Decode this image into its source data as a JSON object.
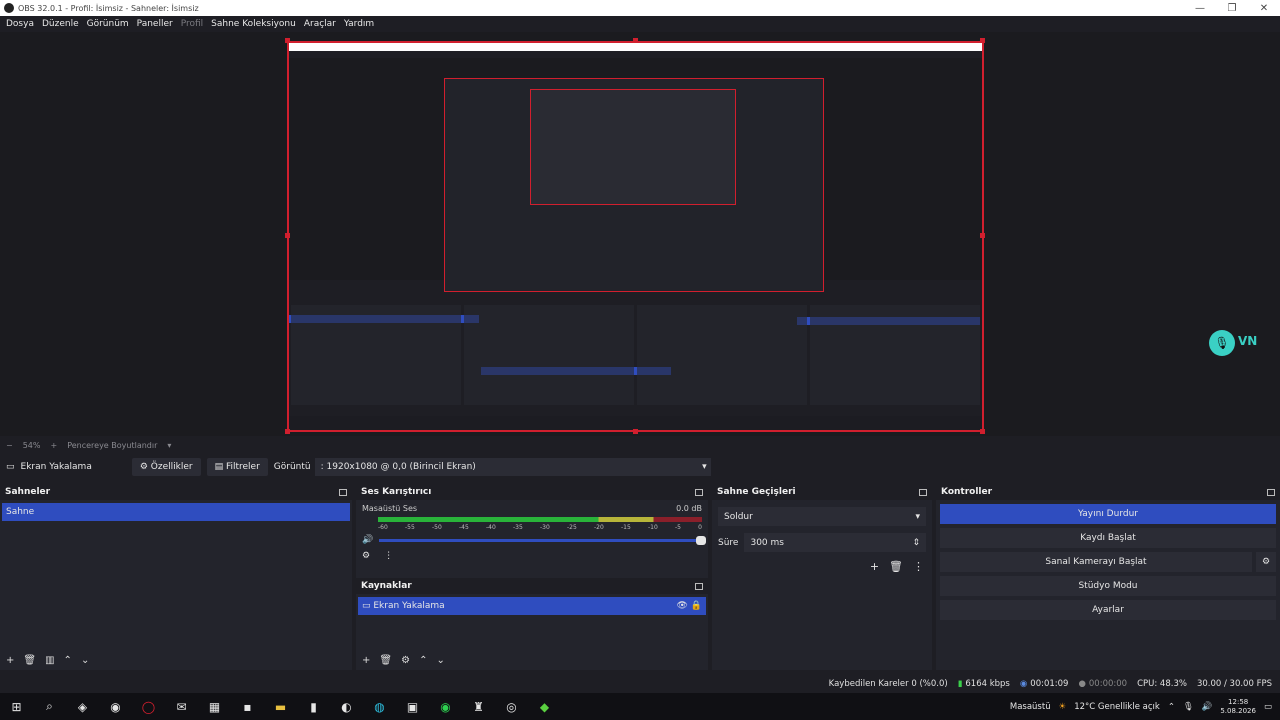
{
  "window": {
    "title": "OBS 32.0.1 - Profil: İsimsiz - Sahneler: İsimsiz"
  },
  "menu": [
    "Dosya",
    "Düzenle",
    "Görünüm",
    "Paneller",
    "Profil",
    "Sahne Koleksiyonu",
    "Araçlar",
    "Yardım"
  ],
  "zoom": {
    "minus": "−",
    "value": "54%",
    "plus": "+",
    "fit": "Pencereye Boyutlandır"
  },
  "source_toolbar": {
    "source_name": "Ekran Yakalama",
    "properties": "Özellikler",
    "filters": "Filtreler",
    "display_label": "Görüntü",
    "display_value": ": 1920x1080 @ 0,0 (Birincil Ekran)"
  },
  "scenes": {
    "title": "Sahneler",
    "items": [
      "Sahne"
    ]
  },
  "mixer": {
    "title": "Ses Karıştırıcı",
    "channel": "Masaüstü Ses",
    "db": "0.0 dB",
    "ticks": [
      "-60",
      "-55",
      "-50",
      "-45",
      "-40",
      "-35",
      "-30",
      "-25",
      "-20",
      "-15",
      "-10",
      "-5",
      "0"
    ]
  },
  "sources": {
    "title": "Kaynaklar",
    "items": [
      "Ekran Yakalama"
    ]
  },
  "transitions": {
    "title": "Sahne Geçişleri",
    "type": "Soldur",
    "duration_label": "Süre",
    "duration_value": "300 ms"
  },
  "controls": {
    "title": "Kontroller",
    "stop_stream": "Yayını Durdur",
    "start_record": "Kaydı Başlat",
    "virtual_cam": "Sanal Kamerayı Başlat",
    "studio_mode": "Stüdyo Modu",
    "settings": "Ayarlar"
  },
  "status": {
    "dropped": "Kaybedilen Kareler 0 (%0.0)",
    "bitrate": "6164 kbps",
    "stream_time": "00:01:09",
    "record_time": "00:00:00",
    "cpu": "CPU: 48.3%",
    "fps": "30.00 / 30.00 FPS"
  },
  "overlay": {
    "mic_label": "VN"
  },
  "taskbar": {
    "desktop_label": "Masaüstü",
    "weather": "12°C  Genellikle açık",
    "time": "12:58",
    "date": "5.08.2026"
  }
}
